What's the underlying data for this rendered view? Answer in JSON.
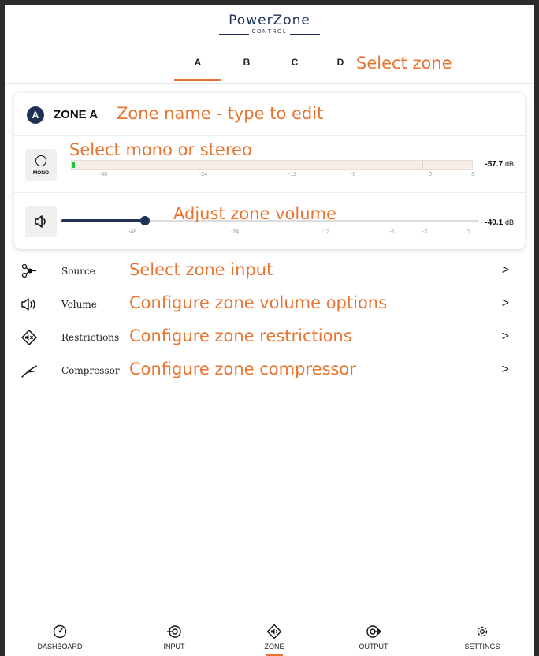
{
  "app": {
    "logo_name": "PowerZone",
    "logo_sub": "CONTROL"
  },
  "zone_tabs": [
    {
      "label": "A",
      "active": true
    },
    {
      "label": "B",
      "active": false
    },
    {
      "label": "C",
      "active": false
    },
    {
      "label": "D",
      "active": false
    }
  ],
  "annotations": {
    "select_zone": "Select zone",
    "zone_name": "Zone name - type to edit",
    "mono_stereo": "Select mono or stereo",
    "volume": "Adjust zone volume",
    "source": "Select zone input",
    "volume_options": "Configure zone volume options",
    "restrictions": "Configure zone restrictions",
    "compressor": "Configure zone compressor"
  },
  "zone": {
    "badge": "A",
    "name": "ZONE A"
  },
  "meter": {
    "mode_label": "MONO",
    "level_db": "-57.7",
    "unit": "dB",
    "scale": [
      "-48",
      "-24",
      "-12",
      "-6",
      "0",
      "3"
    ],
    "level_fraction": 0.01
  },
  "volume": {
    "level_db": "-40.1",
    "unit": "dB",
    "scale": [
      "-48",
      "-24",
      "-12",
      "-6",
      "-3",
      "0"
    ],
    "level_fraction": 0.2
  },
  "menu": [
    {
      "label": "Source",
      "icon": "source-icon"
    },
    {
      "label": "Volume",
      "icon": "speaker-icon"
    },
    {
      "label": "Restrictions",
      "icon": "restrictions-icon"
    },
    {
      "label": "Compressor",
      "icon": "compressor-icon"
    }
  ],
  "chevron": ">",
  "bottom_nav": [
    {
      "label": "DASHBOARD",
      "icon": "dashboard-icon",
      "active": false
    },
    {
      "label": "INPUT",
      "icon": "input-icon",
      "active": false
    },
    {
      "label": "ZONE",
      "icon": "zone-icon",
      "active": true
    },
    {
      "label": "OUTPUT",
      "icon": "output-icon",
      "active": false
    },
    {
      "label": "SETTINGS",
      "icon": "settings-icon",
      "active": false
    }
  ],
  "colors": {
    "accent": "#e8742f",
    "navy": "#1e3157",
    "meter_green": "#22c92e"
  }
}
